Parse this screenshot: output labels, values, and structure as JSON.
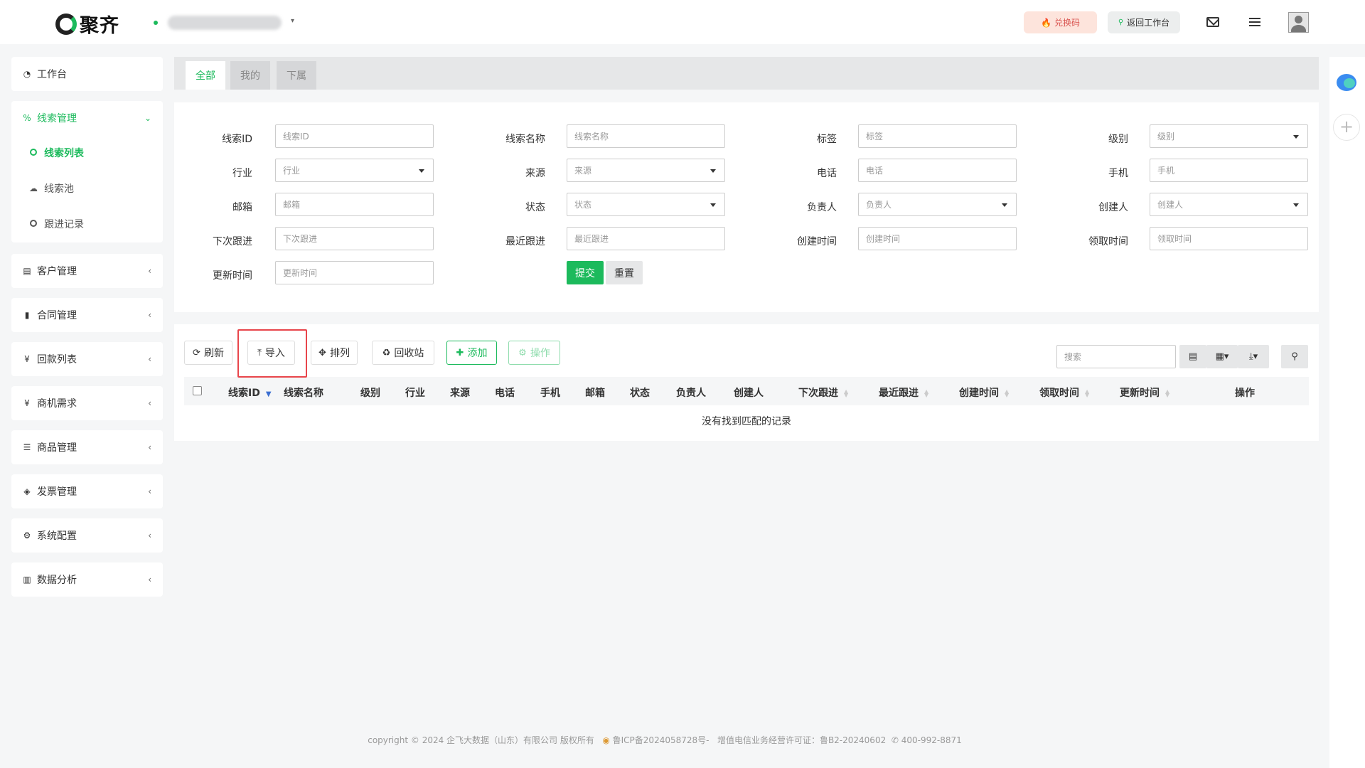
{
  "header": {
    "logo_text": "聚齐",
    "redeem_label": "兑换码",
    "back_label": "返回工作台"
  },
  "sidebar": {
    "workbench": "工作台",
    "leads": {
      "label": "线索管理",
      "children": [
        "线索列表",
        "线索池",
        "跟进记录"
      ]
    },
    "groups": [
      "客户管理",
      "合同管理",
      "回款列表",
      "商机需求",
      "商品管理",
      "发票管理",
      "系统配置",
      "数据分析"
    ]
  },
  "tabs": [
    "全部",
    "我的",
    "下属"
  ],
  "filters": {
    "lead_id": {
      "label": "线索ID",
      "placeholder": "线索ID"
    },
    "lead_name": {
      "label": "线索名称",
      "placeholder": "线索名称"
    },
    "tag": {
      "label": "标签",
      "placeholder": "标签"
    },
    "level": {
      "label": "级别",
      "placeholder": "级别"
    },
    "industry": {
      "label": "行业",
      "placeholder": "行业"
    },
    "source": {
      "label": "来源",
      "placeholder": "来源"
    },
    "phone": {
      "label": "电话",
      "placeholder": "电话"
    },
    "mobile": {
      "label": "手机",
      "placeholder": "手机"
    },
    "email": {
      "label": "邮箱",
      "placeholder": "邮箱"
    },
    "status": {
      "label": "状态",
      "placeholder": "状态"
    },
    "owner": {
      "label": "负责人",
      "placeholder": "负责人"
    },
    "creator": {
      "label": "创建人",
      "placeholder": "创建人"
    },
    "next_follow": {
      "label": "下次跟进",
      "placeholder": "下次跟进"
    },
    "last_follow": {
      "label": "最近跟进",
      "placeholder": "最近跟进"
    },
    "created_time": {
      "label": "创建时间",
      "placeholder": "创建时间"
    },
    "claimed_time": {
      "label": "领取时间",
      "placeholder": "领取时间"
    },
    "updated_time": {
      "label": "更新时间",
      "placeholder": "更新时间"
    },
    "submit_label": "提交",
    "reset_label": "重置"
  },
  "toolbar": {
    "refresh": "刷新",
    "import": "导入",
    "columns": "排列",
    "recycle": "回收站",
    "add": "添加",
    "operate": "操作",
    "search_placeholder": "搜索"
  },
  "table": {
    "columns": [
      "线索ID",
      "线索名称",
      "级别",
      "行业",
      "来源",
      "电话",
      "手机",
      "邮箱",
      "状态",
      "负责人",
      "创建人",
      "下次跟进",
      "最近跟进",
      "创建时间",
      "领取时间",
      "更新时间",
      "操作"
    ],
    "empty_text": "没有找到匹配的记录"
  },
  "footer": {
    "copyright": "copyright © 2024 企飞大数据（山东）有限公司 版权所有",
    "icp": "鲁ICP备2024058728号-",
    "license": "增值电信业务经营许可证：鲁B2-20240602",
    "phone": "400-992-8871"
  },
  "colors": {
    "accent": "#1cba5c",
    "highlight": "#e8454b"
  }
}
